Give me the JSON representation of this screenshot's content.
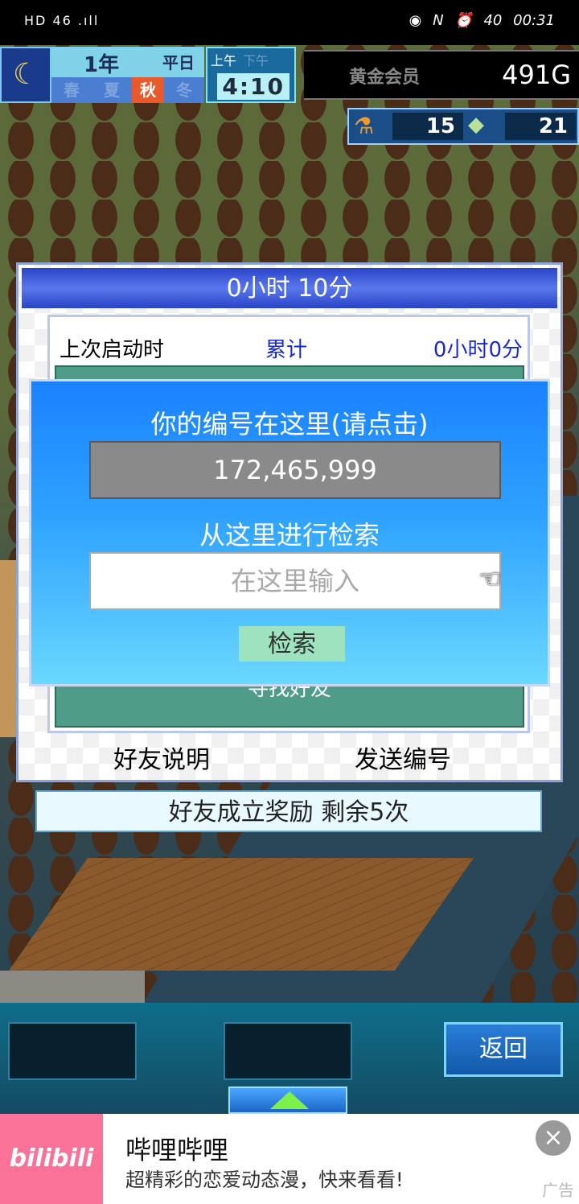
{
  "status_bar": {
    "left": "HD 46 .ıll",
    "icons": [
      "eye",
      "N",
      "alarm"
    ],
    "battery": "40",
    "time": "00:31"
  },
  "hud": {
    "year": "1年",
    "day_type": "平日",
    "seasons": [
      "春",
      "夏",
      "秋",
      "冬"
    ],
    "active_season": "秋",
    "am": "上午",
    "pm": "下午",
    "clock": "4:10",
    "membership": "黄金会员",
    "gold": "491G",
    "research_points": "15",
    "tickets": "21"
  },
  "dialog": {
    "title": "0小时 10分",
    "last_launch_label": "上次启动时",
    "total_label": "累计",
    "total_value": "0小时0分",
    "hidden_button": "寻找好友",
    "friend_help": "好友说明",
    "send_id": "发送编号"
  },
  "popup": {
    "id_label": "你的编号在这里(请点击)",
    "id_value": "172,465,999",
    "search_label": "从这里进行检索",
    "search_placeholder": "在这里输入",
    "search_button": "检索"
  },
  "reward": "好友成立奖励  剩余5次",
  "bottom_bar": {
    "back_label": "返回"
  },
  "ad": {
    "brand": "bilibili",
    "title": "哔哩哔哩",
    "subtitle": "超精彩的恋爱动态漫，快来看看!",
    "tag": "广告",
    "close_icon": "×"
  }
}
